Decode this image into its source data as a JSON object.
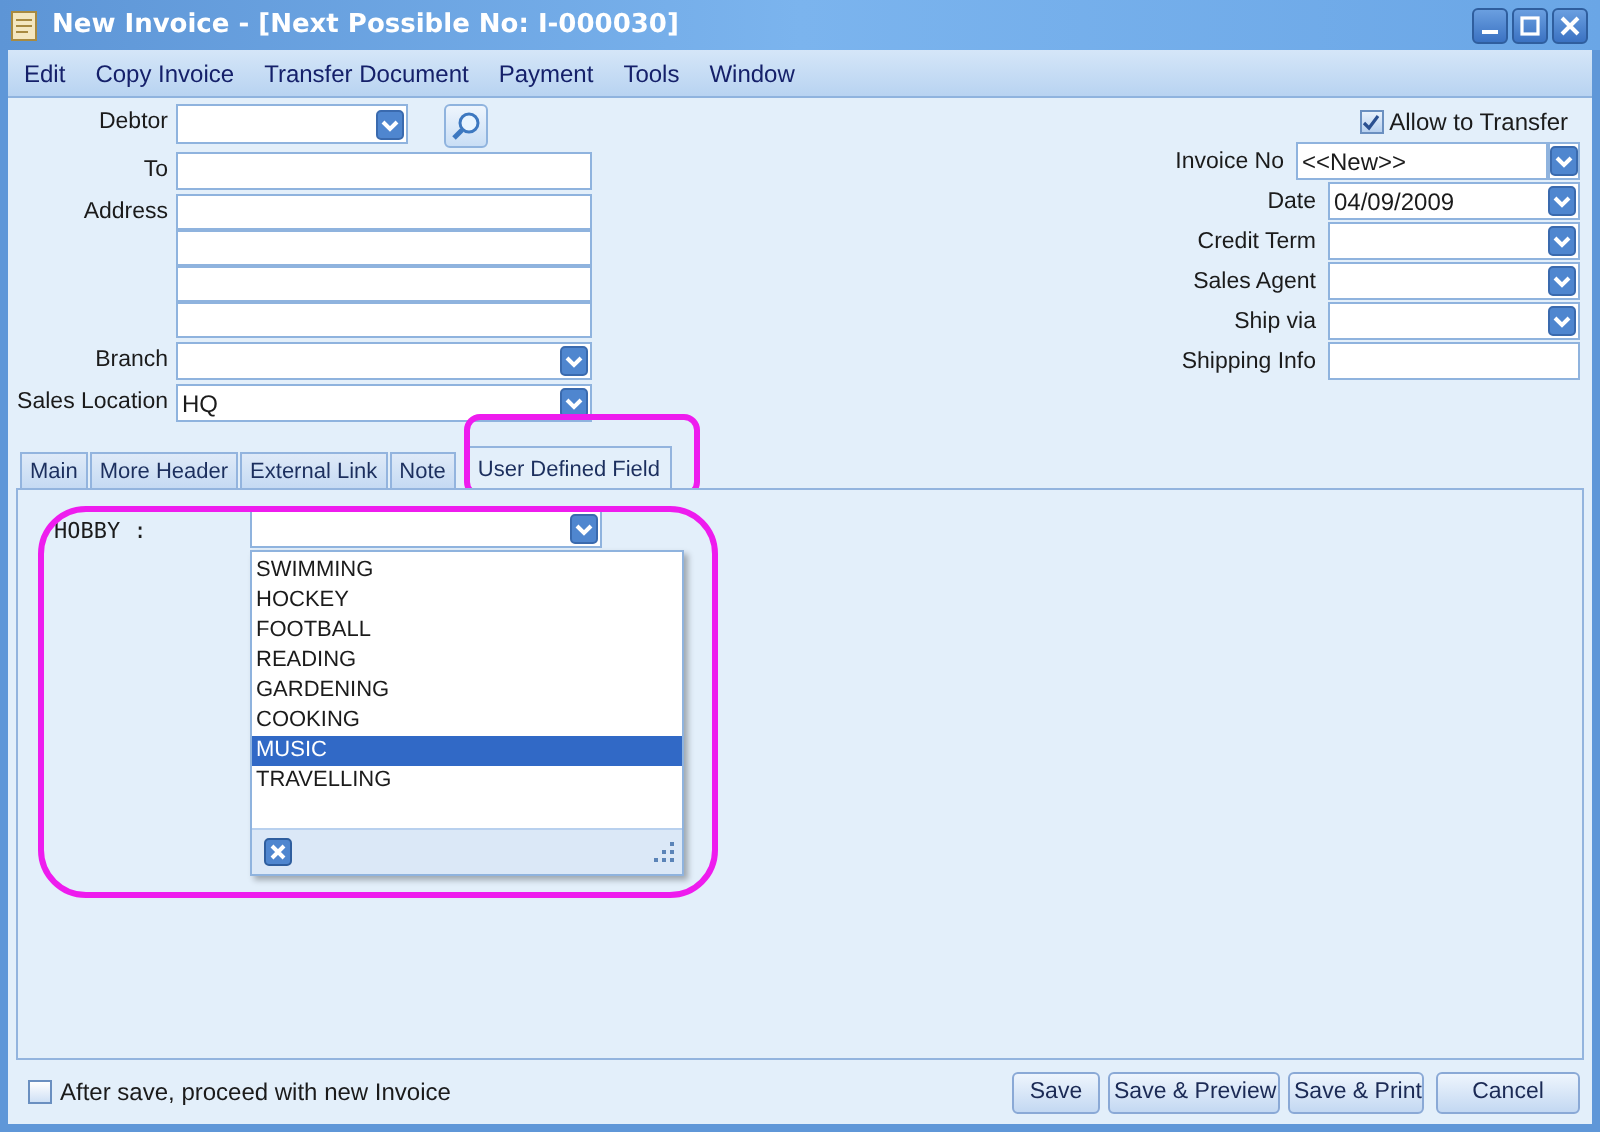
{
  "window": {
    "title": "New Invoice - [Next Possible No: I-000030]"
  },
  "menu": [
    "Edit",
    "Copy Invoice",
    "Transfer Document",
    "Payment",
    "Tools",
    "Window"
  ],
  "header_left": [
    {
      "label": "Debtor",
      "kind": "combo-search"
    },
    {
      "label": "To",
      "kind": "text"
    },
    {
      "label": "Address",
      "kind": "address"
    },
    {
      "label": "Branch",
      "kind": "combo"
    },
    {
      "label": "Sales Location",
      "kind": "combo",
      "value": "HQ"
    }
  ],
  "allow_transfer": {
    "label": "Allow to Transfer",
    "checked": true
  },
  "header_right": [
    {
      "label": "Invoice No",
      "kind": "split-combo",
      "value": "<<New>>"
    },
    {
      "label": "Date",
      "kind": "combo",
      "value": "04/09/2009"
    },
    {
      "label": "Credit Term",
      "kind": "combo"
    },
    {
      "label": "Sales Agent",
      "kind": "combo"
    },
    {
      "label": "Ship via",
      "kind": "combo"
    },
    {
      "label": "Shipping Info",
      "kind": "text"
    }
  ],
  "tabs": [
    {
      "label": "Main",
      "selected": false
    },
    {
      "label": "More Header",
      "selected": false
    },
    {
      "label": "External Link",
      "selected": false
    },
    {
      "label": "Note",
      "selected": false
    },
    {
      "label": "User Defined Field",
      "selected": true
    }
  ],
  "hobby": {
    "label": "HOBBY :",
    "expanded": true,
    "options": [
      {
        "label": "SWIMMING",
        "selected": false
      },
      {
        "label": "HOCKEY",
        "selected": false
      },
      {
        "label": "FOOTBALL",
        "selected": false
      },
      {
        "label": "READING",
        "selected": false
      },
      {
        "label": "GARDENING",
        "selected": false
      },
      {
        "label": "COOKING",
        "selected": false
      },
      {
        "label": "MUSIC",
        "selected": true
      },
      {
        "label": "TRAVELLING",
        "selected": false
      }
    ]
  },
  "highlights": {
    "tab": true,
    "hobby": true
  },
  "footer": {
    "checkbox": {
      "label": "After save, proceed with new Invoice",
      "checked": false
    },
    "buttons": [
      "Save",
      "Save & Preview",
      "Save & Print",
      "Cancel"
    ]
  }
}
